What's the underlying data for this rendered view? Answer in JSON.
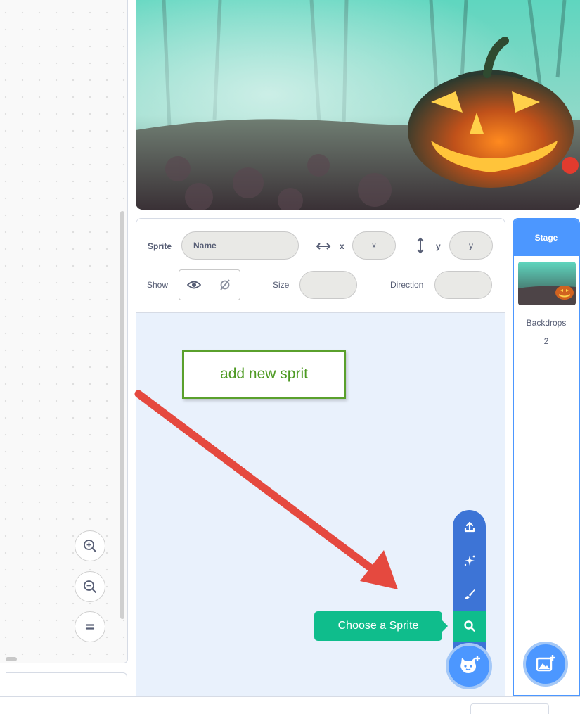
{
  "workspace": {
    "zoom_in_icon": "zoom-in-icon",
    "zoom_out_icon": "zoom-out-icon",
    "zoom_reset_icon": "equals-icon"
  },
  "sprite_info": {
    "sprite_label": "Sprite",
    "name_placeholder": "Name",
    "x_label": "x",
    "x_placeholder": "x",
    "y_label": "y",
    "y_placeholder": "y",
    "show_label": "Show",
    "size_label": "Size",
    "direction_label": "Direction"
  },
  "callout": {
    "text": "add new sprit",
    "border_color": "#5aa02c",
    "arrow_color": "#e5493f"
  },
  "sprite_menu": {
    "tooltip": "Choose a Sprite",
    "items": [
      "upload-icon",
      "surprise-icon",
      "paint-icon",
      "search-icon"
    ],
    "accent": "#4c97ff",
    "search_color": "#0fbd8c"
  },
  "stage_pane": {
    "header": "Stage",
    "backdrops_label": "Backdrops",
    "backdrops_count": "2"
  }
}
